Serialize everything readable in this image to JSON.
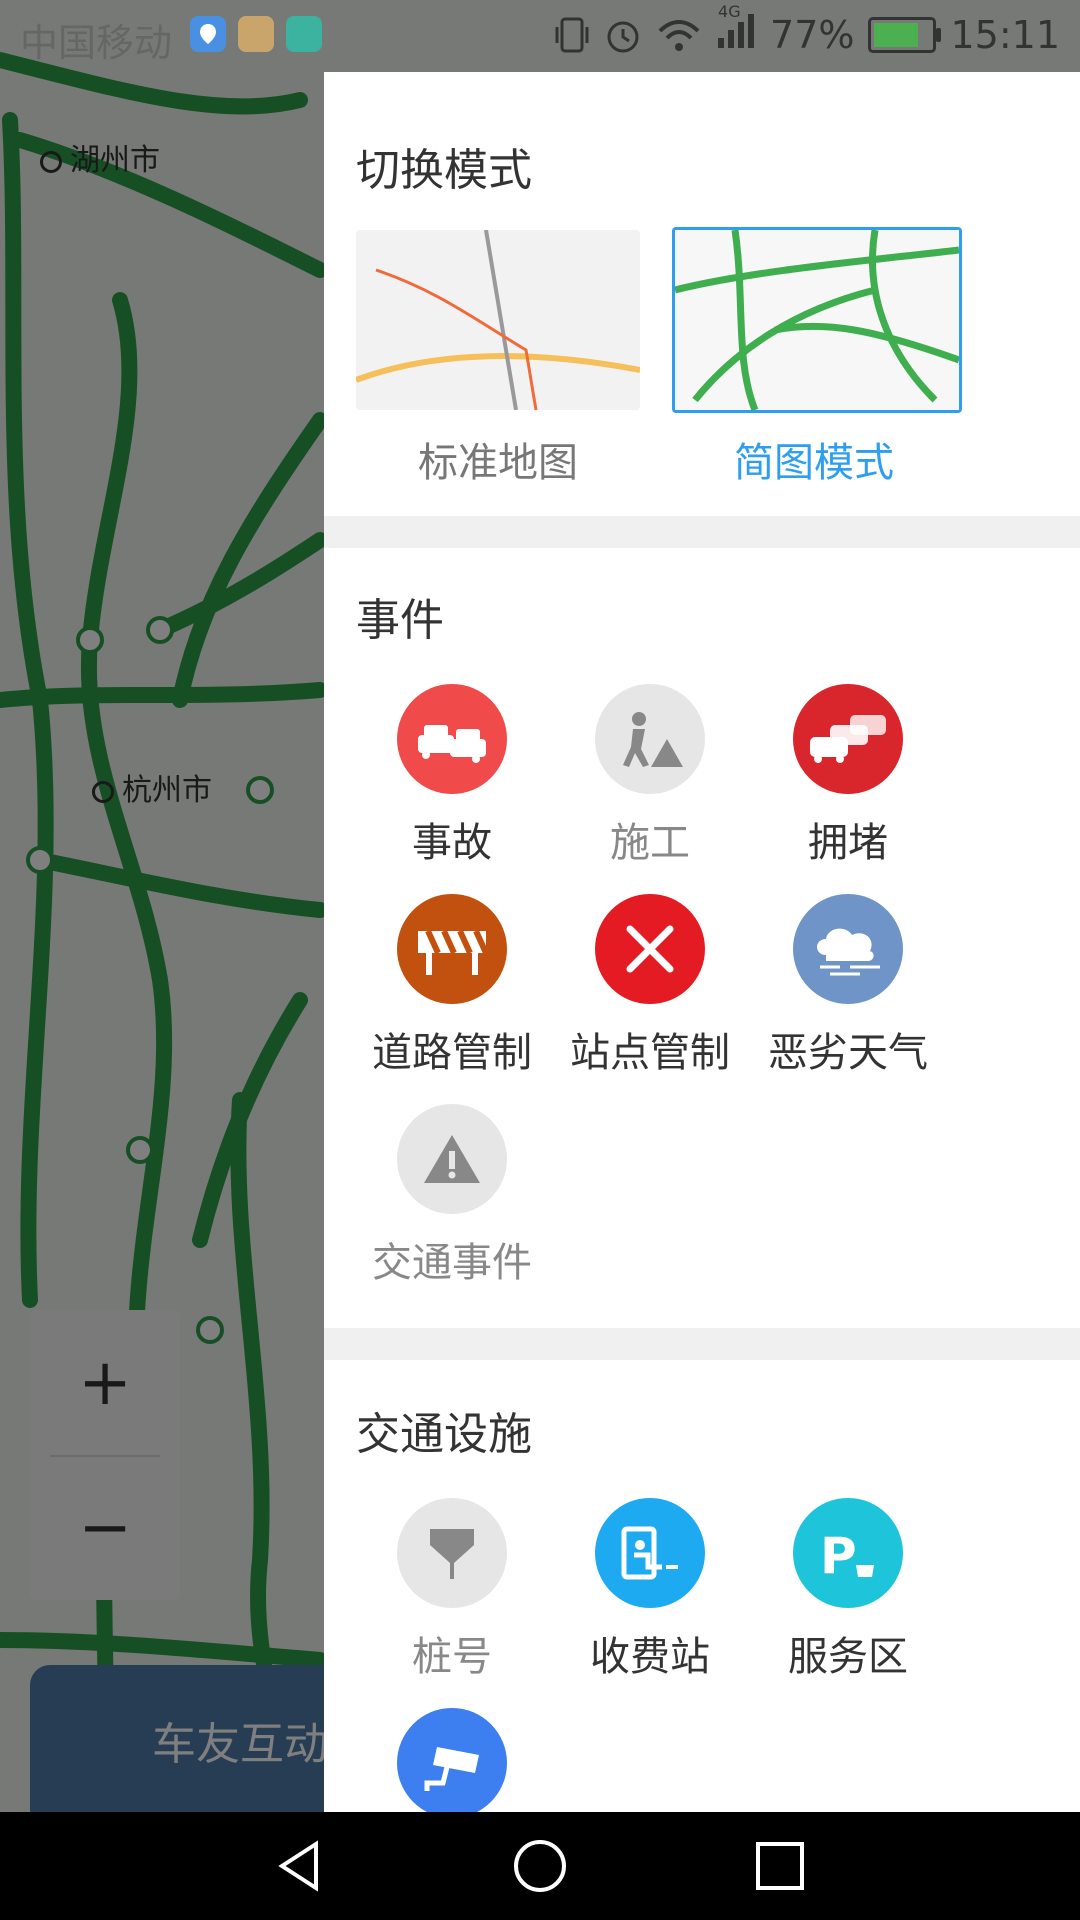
{
  "status_bar": {
    "carrier": "中国移动",
    "network_badge": "4G",
    "battery": "77%",
    "time": "15:11",
    "battery_color": "#4caf50"
  },
  "map": {
    "cities": [
      "湖州市",
      "杭州市"
    ],
    "zoom_in": "+",
    "zoom_out": "−",
    "bottom_tab": "车友互动"
  },
  "drawer": {
    "mode_title": "切换模式",
    "modes": [
      {
        "label": "标准地图",
        "active": false
      },
      {
        "label": "简图模式",
        "active": true
      }
    ],
    "events_title": "事件",
    "events": [
      {
        "label": "事故",
        "icon": "car-accident-icon",
        "color": "#f04a4a"
      },
      {
        "label": "施工",
        "icon": "construction-worker-icon",
        "color": "#e6e6e6",
        "dim": true
      },
      {
        "label": "拥堵",
        "icon": "traffic-jam-icon",
        "color": "#d9262c"
      },
      {
        "label": "道路管制",
        "icon": "road-barrier-icon",
        "color": "#c2510f"
      },
      {
        "label": "站点管制",
        "icon": "close-icon",
        "color": "#e51b24"
      },
      {
        "label": "恶劣天气",
        "icon": "storm-cloud-icon",
        "color": "#6f95c8"
      },
      {
        "label": "交通事件",
        "icon": "warning-triangle-icon",
        "color": "#e6e6e6",
        "dim": true
      }
    ],
    "facilities_title": "交通设施",
    "facilities": [
      {
        "label": "桩号",
        "icon": "milestone-icon",
        "color": "#e6e6e6",
        "dim": true
      },
      {
        "label": "收费站",
        "icon": "toll-booth-icon",
        "color": "#1eaaf1"
      },
      {
        "label": "服务区",
        "icon": "parking-service-icon",
        "color": "#1ec4d9"
      },
      {
        "label": "",
        "icon": "traffic-camera-icon",
        "color": "#3d7ef0"
      }
    ],
    "accent_color": "#2d9ef0"
  }
}
